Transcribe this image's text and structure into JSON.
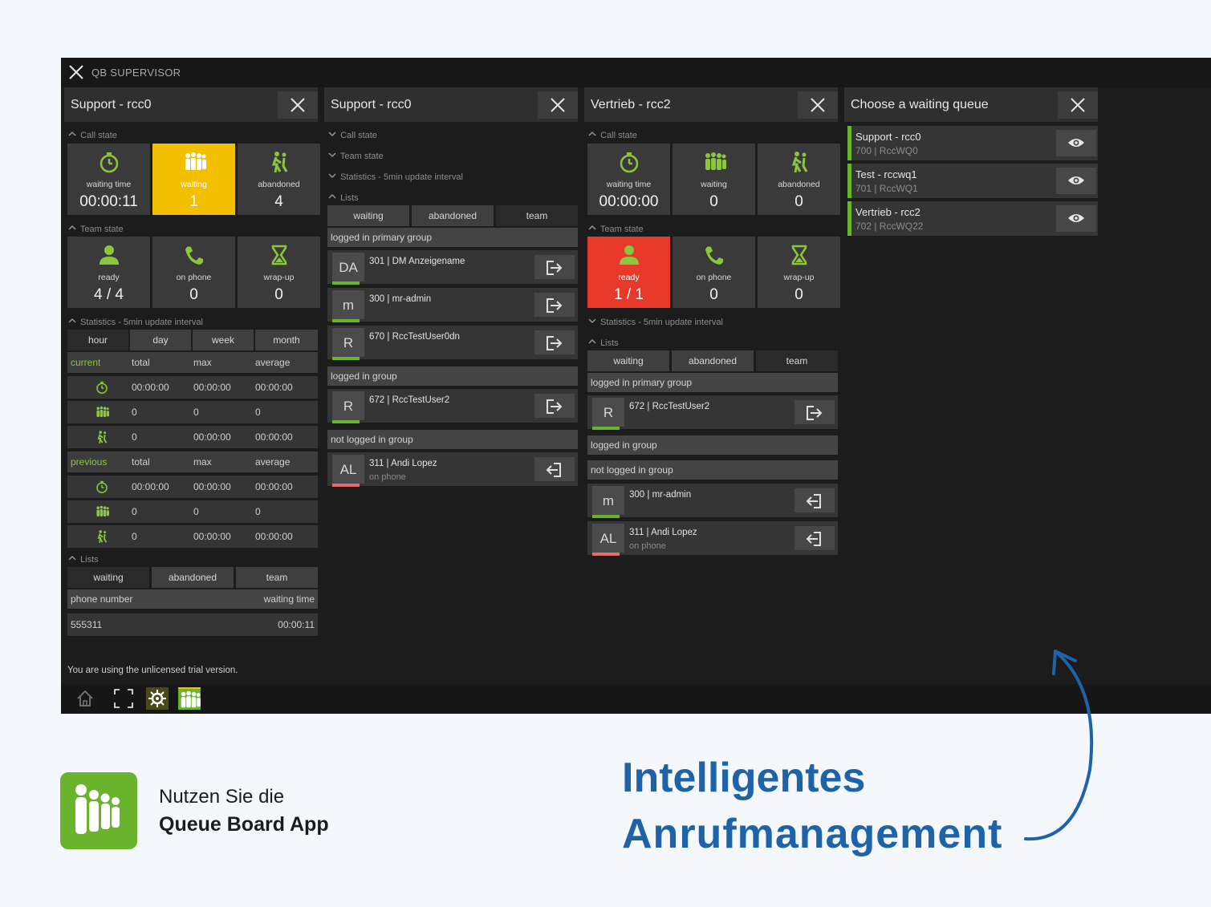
{
  "window": {
    "title": "QB SUPERVISOR"
  },
  "panel1": {
    "title": "Support - rcc0",
    "call_state_label": "Call state",
    "tiles_call": [
      {
        "label": "waiting time",
        "value": "00:00:11"
      },
      {
        "label": "waiting",
        "value": "1"
      },
      {
        "label": "abandoned",
        "value": "4"
      }
    ],
    "team_state_label": "Team state",
    "tiles_team": [
      {
        "label": "ready",
        "value": "4 / 4"
      },
      {
        "label": "on phone",
        "value": "0"
      },
      {
        "label": "wrap-up",
        "value": "0"
      }
    ],
    "stats_label": "Statistics - 5min update interval",
    "stats_tabs": [
      "hour",
      "day",
      "week",
      "month"
    ],
    "current_header": [
      "current",
      "total",
      "max",
      "average"
    ],
    "current_rows": [
      [
        "00:00:00",
        "00:00:00",
        "00:00:00"
      ],
      [
        "0",
        "0",
        "0"
      ],
      [
        "0",
        "00:00:00",
        "00:00:00"
      ]
    ],
    "previous_header": [
      "previous",
      "total",
      "max",
      "average"
    ],
    "previous_rows": [
      [
        "00:00:00",
        "00:00:00",
        "00:00:00"
      ],
      [
        "0",
        "0",
        "0"
      ],
      [
        "0",
        "00:00:00",
        "00:00:00"
      ]
    ],
    "lists_label": "Lists",
    "list_tabs": [
      "waiting",
      "abandoned",
      "team"
    ],
    "list_header": [
      "phone number",
      "waiting time"
    ],
    "list_rows": [
      [
        "555311",
        "00:00:11"
      ]
    ]
  },
  "panel2": {
    "title": "Support - rcc0",
    "sections": [
      "Call state",
      "Team state",
      "Statistics - 5min update interval",
      "Lists"
    ],
    "list_tabs": [
      "waiting",
      "abandoned",
      "team"
    ],
    "groups": {
      "primary": "logged in primary group",
      "logged": "logged in group",
      "not_logged": "not logged in group"
    },
    "users_primary": [
      {
        "initials": "DA",
        "name": "301 | DM Anzeigename"
      },
      {
        "initials": "m",
        "name": "300 | mr-admin"
      },
      {
        "initials": "R",
        "name": "670 | RccTestUser0dn"
      }
    ],
    "users_logged": [
      {
        "initials": "R",
        "name": "672 | RccTestUser2"
      }
    ],
    "users_not_logged": [
      {
        "initials": "AL",
        "name": "311 | Andi Lopez",
        "status": "on phone"
      }
    ]
  },
  "panel3": {
    "title": "Vertrieb - rcc2",
    "call_state_label": "Call state",
    "tiles_call": [
      {
        "label": "waiting time",
        "value": "00:00:00"
      },
      {
        "label": "waiting",
        "value": "0"
      },
      {
        "label": "abandoned",
        "value": "0"
      }
    ],
    "team_state_label": "Team state",
    "tiles_team": [
      {
        "label": "ready",
        "value": "1 / 1"
      },
      {
        "label": "on phone",
        "value": "0"
      },
      {
        "label": "wrap-up",
        "value": "0"
      }
    ],
    "stats_label": "Statistics - 5min update interval",
    "lists_label": "Lists",
    "list_tabs": [
      "waiting",
      "abandoned",
      "team"
    ],
    "groups": {
      "primary": "logged in primary group",
      "logged": "logged in group",
      "not_logged": "not logged in group"
    },
    "users_primary": [
      {
        "initials": "R",
        "name": "672 | RccTestUser2"
      }
    ],
    "users_not_logged": [
      {
        "initials": "m",
        "name": "300 | mr-admin"
      },
      {
        "initials": "AL",
        "name": "311 | Andi Lopez",
        "status": "on phone"
      }
    ]
  },
  "panel4": {
    "title": "Choose a waiting queue",
    "queues": [
      {
        "name": "Support - rcc0",
        "sub": "700 | RccWQ0"
      },
      {
        "name": "Test - rccwq1",
        "sub": "701 | RccWQ1"
      },
      {
        "name": "Vertrieb - rcc2",
        "sub": "702 | RccWQ22"
      }
    ]
  },
  "footer": {
    "trial": "You are using the unlicensed trial version."
  },
  "colors": {
    "accent_green": "#6ab42d",
    "waiting_yellow": "#f2c000",
    "ready_red": "#e8392a",
    "slogan_blue": "#1e63a8"
  },
  "promo": {
    "caption_line1": "Nutzen Sie die",
    "caption_line2": "Queue Board App",
    "slogan_line1": "Intelligentes",
    "slogan_line2": "Anrufmanagement"
  }
}
